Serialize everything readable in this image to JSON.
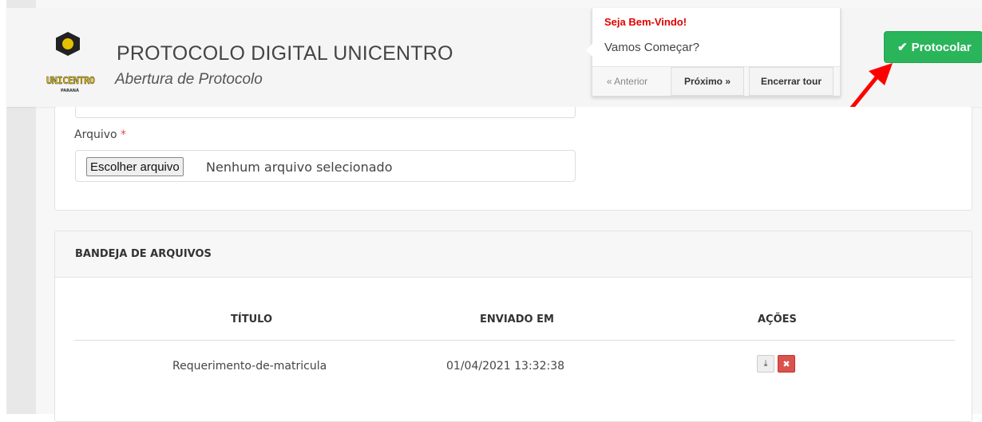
{
  "header": {
    "title": "PROTOCOLO DIGITAL UNICENTRO",
    "subtitle": "Abertura de Protocolo",
    "logo_text": "UNICENTRO",
    "logo_subtext": "PARANÁ"
  },
  "tour": {
    "title": "Seja Bem-Vindo!",
    "body": "Vamos Começar?",
    "prev_label": "« Anterior",
    "next_label": "Próximo »",
    "end_label": "Encerrar tour"
  },
  "actions": {
    "protocolar_label": "Protocolar",
    "protocolar_icon": "check-icon",
    "accent_color": "#2ab55b"
  },
  "upload": {
    "label": "Arquivo",
    "required_mark": "*",
    "choose_button": "Escolher arquivo",
    "status": "Nenhum arquivo selecionado"
  },
  "files_panel": {
    "title": "BANDEJA DE ARQUIVOS",
    "columns": [
      "TÍTULO",
      "ENVIADO EM",
      "AÇÕES"
    ],
    "rows": [
      {
        "title": "Requerimento-de-matricula",
        "sent_at": "01/04/2021 13:32:38",
        "actions": [
          "download-icon",
          "delete-icon"
        ]
      }
    ]
  },
  "annotation": {
    "arrow_color": "#ff0000"
  }
}
